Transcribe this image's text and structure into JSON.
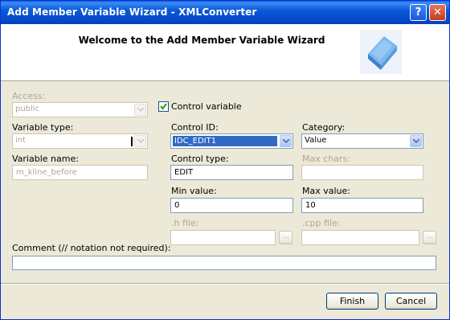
{
  "window": {
    "title": "Add Member Variable Wizard - XMLConverter",
    "help_label": "?",
    "close_label": "✕"
  },
  "header": {
    "title": "Welcome to the Add Member Variable Wizard"
  },
  "access": {
    "label": "Access:",
    "value": "public"
  },
  "control_variable": {
    "label": "Control variable",
    "checked": true
  },
  "variable_type": {
    "label": "Variable type:",
    "value": "int"
  },
  "control_id": {
    "label": "Control ID:",
    "value": "IDC_EDIT1"
  },
  "category": {
    "label": "Category:",
    "value": "Value"
  },
  "variable_name": {
    "label": "Variable name:",
    "placeholder": "m_kline_before"
  },
  "control_type": {
    "label": "Control type:",
    "value": "EDIT"
  },
  "max_chars": {
    "label": "Max chars:",
    "value": ""
  },
  "min_value": {
    "label": "Min value:",
    "value": "0"
  },
  "max_value": {
    "label": "Max value:",
    "value": "10"
  },
  "h_file": {
    "label": ".h file:",
    "value": "",
    "browse": "..."
  },
  "cpp_file": {
    "label": ".cpp file:",
    "value": "",
    "browse": "..."
  },
  "comment": {
    "label": "Comment (// notation not required):",
    "value": ""
  },
  "buttons": {
    "finish": "Finish",
    "cancel": "Cancel"
  }
}
